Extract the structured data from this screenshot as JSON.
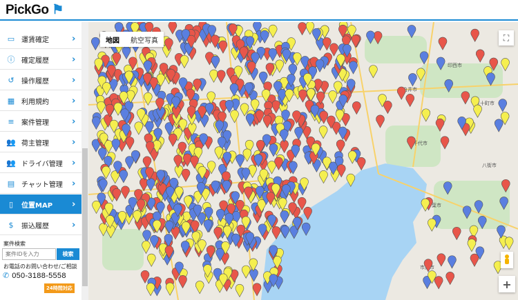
{
  "header": {
    "logo_text": "PickGo"
  },
  "sidebar": {
    "items": [
      {
        "label": "運賃確定",
        "icon": "card-icon"
      },
      {
        "label": "確定履歴",
        "icon": "info-icon"
      },
      {
        "label": "操作履歴",
        "icon": "history-icon"
      },
      {
        "label": "利用規約",
        "icon": "calendar-icon"
      },
      {
        "label": "案件管理",
        "icon": "list-icon"
      },
      {
        "label": "荷主管理",
        "icon": "users-icon"
      },
      {
        "label": "ドライバ管理",
        "icon": "users-icon"
      },
      {
        "label": "チャット管理",
        "icon": "chat-icon"
      },
      {
        "label": "位置MAP",
        "icon": "map-icon",
        "active": true
      },
      {
        "label": "振込履歴",
        "icon": "dollar-icon"
      }
    ],
    "search": {
      "title": "案件検索",
      "placeholder": "案件IDを入力",
      "button": "検索"
    },
    "contact": {
      "text": "お電話のお問い合わせ/ご相談",
      "phone": "050-3188-5558",
      "badge": "24時間対応"
    }
  },
  "map": {
    "type_buttons": [
      "地図",
      "航空写真"
    ],
    "fullscreen": "⛶",
    "zoom_in": "+",
    "pin_colors": {
      "red": "#e8564a",
      "blue": "#5a7fe0",
      "yellow": "#f5ef4f"
    },
    "water_color": "#a8d4f4",
    "place_names": [
      "印西市",
      "白井市",
      "千代市",
      "中葉市",
      "市原市",
      "五十町市",
      "八街市"
    ]
  }
}
